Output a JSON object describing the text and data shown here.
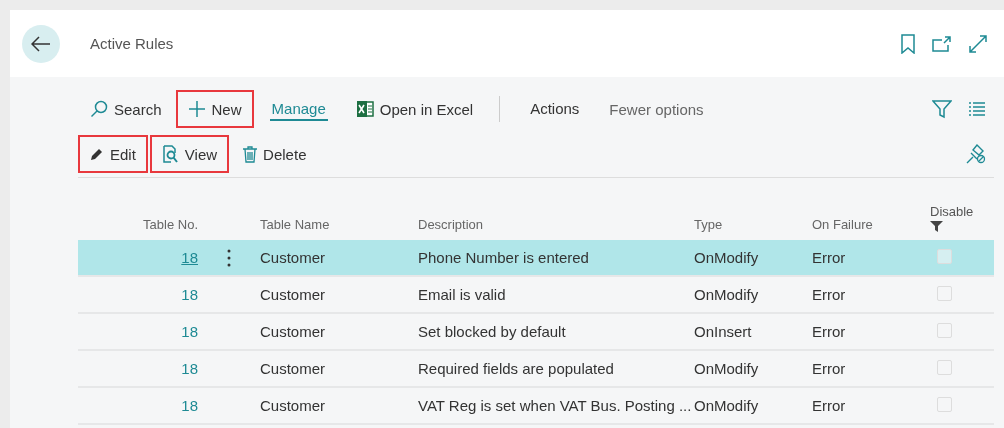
{
  "page": {
    "title": "Active Rules"
  },
  "toolbar": {
    "row_1": [
      {
        "kind": "search",
        "label": "Search",
        "highlighted": false
      },
      {
        "kind": "new",
        "label": "New",
        "highlighted": true
      },
      {
        "kind": "tab",
        "label": "Manage",
        "selected": true
      },
      {
        "kind": "excel",
        "label": "Open in Excel",
        "highlighted": false
      },
      {
        "kind": "separator"
      },
      {
        "kind": "tab",
        "label": "Actions",
        "selected": false
      },
      {
        "kind": "toggle",
        "label": "Fewer options",
        "highlighted": false
      }
    ],
    "row_2": [
      {
        "kind": "edit",
        "label": "Edit",
        "highlighted": true
      },
      {
        "kind": "view",
        "label": "View",
        "highlighted": true
      },
      {
        "kind": "delete",
        "label": "Delete",
        "highlighted": false
      }
    ]
  },
  "table": {
    "columns": [
      {
        "label": "Table No.",
        "filtered": false
      },
      {
        "label": "Table Name",
        "filtered": false
      },
      {
        "label": "Description",
        "filtered": false
      },
      {
        "label": "Type",
        "filtered": false
      },
      {
        "label": "On Failure",
        "filtered": false
      },
      {
        "label": "Disable",
        "filtered": true
      }
    ],
    "rows": [
      {
        "table_no": "18",
        "table_name": "Customer",
        "description": "Phone Number is entered",
        "type": "OnModify",
        "on_failure": "Error",
        "disable": false,
        "selected": true
      },
      {
        "table_no": "18",
        "table_name": "Customer",
        "description": "Email is valid",
        "type": "OnModify",
        "on_failure": "Error",
        "disable": false,
        "selected": false
      },
      {
        "table_no": "18",
        "table_name": "Customer",
        "description": "Set blocked by default",
        "type": "OnInsert",
        "on_failure": "Error",
        "disable": false,
        "selected": false
      },
      {
        "table_no": "18",
        "table_name": "Customer",
        "description": "Required fields are populated",
        "type": "OnModify",
        "on_failure": "Error",
        "disable": false,
        "selected": false
      },
      {
        "table_no": "18",
        "table_name": "Customer",
        "description": "VAT Reg is set when VAT Bus. Posting ...",
        "type": "OnModify",
        "on_failure": "Error",
        "disable": false,
        "selected": false
      }
    ]
  }
}
